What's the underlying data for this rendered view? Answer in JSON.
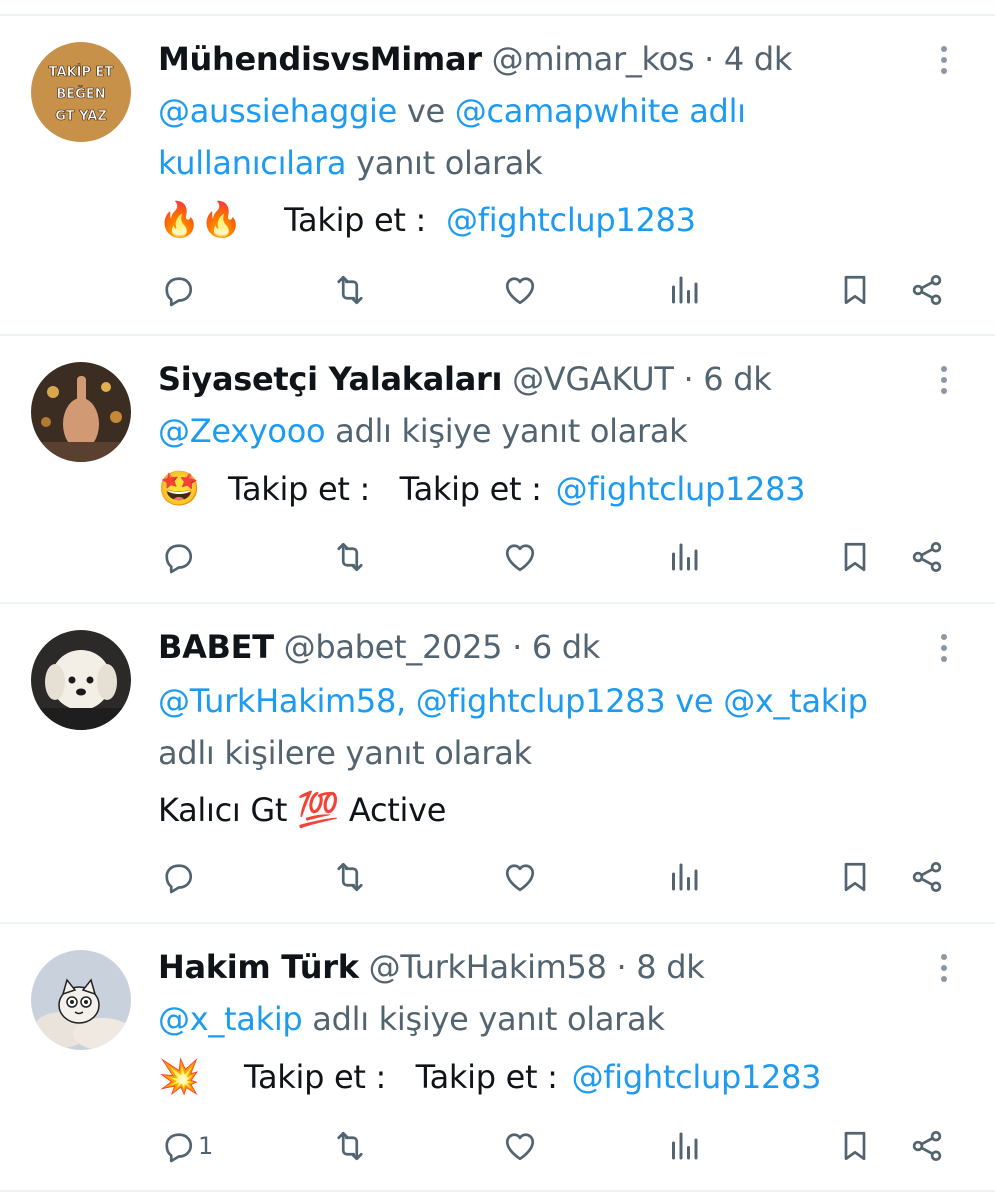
{
  "tweets": [
    {
      "name": "MühendisvsMimar",
      "handle": "@mimar_kos",
      "sep": " · ",
      "time": "4 dk",
      "avatar_text": [
        "TAKİP ET",
        "BEĞEN",
        "GT YAZ"
      ],
      "reply_line1_m1": "@aussiehaggie",
      "reply_line1_t1": " ve ",
      "reply_line1_m2": "@camapwhite adlı",
      "reply_line2_m": "kullanıcılara",
      "reply_line2_t": " yanıt olarak",
      "body_emoji": "🔥🔥",
      "body_text": "Takip et :",
      "body_mention": "@fightclup1283",
      "reply_count": ""
    },
    {
      "name": "Siyasetçi Yalakaları",
      "handle": "@VGAKUT",
      "sep": " · ",
      "time": "6 dk",
      "reply_m": "@Zexyooo",
      "reply_t": " adlı kişiye yanıt olarak",
      "body_emoji": "🤩",
      "body_text": "Takip et :   Takip et :",
      "body_mention": "@fightclup1283",
      "reply_count": ""
    },
    {
      "name": "BABET",
      "handle": "@babet_2025",
      "sep": " · ",
      "time": "6 dk",
      "reply_line1_m1": "@TurkHakim58,",
      "reply_line1_m2": "@fightclup1283",
      "reply_line1_t": " ve ",
      "reply_line1_m3": "@x_takip",
      "reply_line2_t": "adlı kişilere yanıt olarak",
      "body_text1": "Kalıcı Gt ",
      "body_emoji": "💯",
      "body_text2": " Active",
      "reply_count": ""
    },
    {
      "name": "Hakim Türk",
      "handle": "@TurkHakim58",
      "sep": " · ",
      "time": "8 dk",
      "reply_m": "@x_takip",
      "reply_t": " adlı kişiye yanıt olarak",
      "body_emoji": "💥",
      "body_text": "Takip et :   Takip et :",
      "body_mention": "@fightclup1283",
      "reply_count": "1"
    }
  ],
  "colors": {
    "link": "#1d9bf0",
    "muted": "#536471",
    "text": "#0f1419",
    "divider": "#eff3f4"
  },
  "icons": [
    "reply-icon",
    "retweet-icon",
    "like-icon",
    "views-icon",
    "bookmark-icon",
    "share-icon",
    "more-icon"
  ]
}
